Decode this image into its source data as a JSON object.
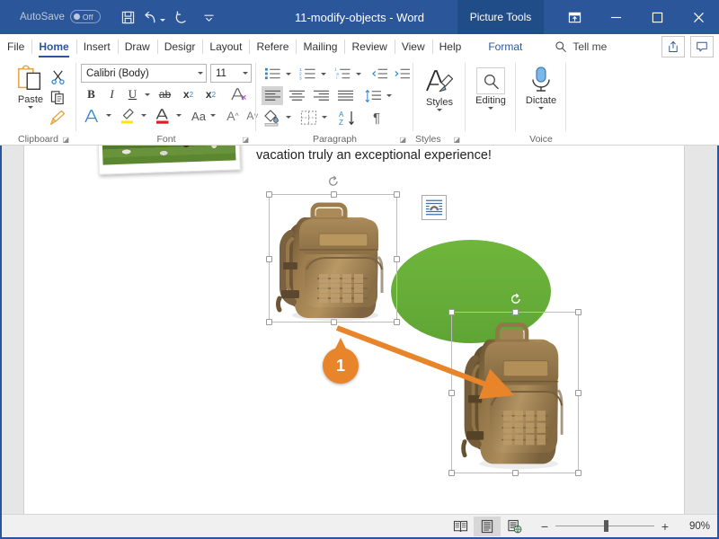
{
  "titlebar": {
    "autosave_label": "AutoSave",
    "autosave_state": "Off",
    "document_title": "11-modify-objects - Word",
    "contextual_tab": "Picture Tools",
    "qat": [
      {
        "name": "save-button",
        "icon": "save-icon"
      },
      {
        "name": "undo-button",
        "icon": "undo-icon"
      },
      {
        "name": "redo-button",
        "icon": "redo-icon"
      },
      {
        "name": "customize-quick-access-toolbar-button",
        "icon": "chevron-down-icon"
      }
    ],
    "window_controls": [
      {
        "name": "ribbon-display-options-button",
        "icon": "ribbon-display-icon"
      },
      {
        "name": "minimize-button",
        "icon": "minimize-icon"
      },
      {
        "name": "maximize-button",
        "icon": "maximize-icon"
      },
      {
        "name": "close-button",
        "icon": "close-icon"
      }
    ]
  },
  "tabs": [
    {
      "label": "File",
      "active": false
    },
    {
      "label": "Home",
      "active": true
    },
    {
      "label": "Insert",
      "active": false
    },
    {
      "label": "Draw",
      "active": false
    },
    {
      "label": "Desigr",
      "active": false
    },
    {
      "label": "Layout",
      "active": false
    },
    {
      "label": "Refere",
      "active": false
    },
    {
      "label": "Mailing",
      "active": false
    },
    {
      "label": "Review",
      "active": false
    },
    {
      "label": "View",
      "active": false
    },
    {
      "label": "Help",
      "active": false
    }
  ],
  "format_tab": "Format",
  "tell_me": "Tell me",
  "ribbon": {
    "groups": [
      {
        "name": "clipboard",
        "title": "Clipboard"
      },
      {
        "name": "font",
        "title": "Font"
      },
      {
        "name": "paragraph",
        "title": "Paragraph"
      },
      {
        "name": "styles",
        "title": "Styles"
      },
      {
        "name": "voice",
        "title": "Voice"
      }
    ],
    "clipboard": {
      "paste_label": "Paste",
      "cut_name": "cut-button",
      "copy_name": "copy-button",
      "format_painter_name": "format-painter-button"
    },
    "font": {
      "font_name": "Calibri (Body)",
      "font_size": "11",
      "bold": "B",
      "italic": "I",
      "underline": "U",
      "strikethrough": "ab",
      "subscript": "x",
      "superscript": "x",
      "grow_font": "A",
      "shrink_font": "A",
      "change_case": "Aa"
    },
    "styles": {
      "label": "Styles"
    },
    "editing": {
      "label": "Editing"
    },
    "voice": {
      "label": "Dictate"
    }
  },
  "document": {
    "text": "vacation truly an exceptional experience!",
    "photo_alt": "grass-photo-thumbnail",
    "shape_color": "#6FB63C",
    "badge_number": "1",
    "badge_color": "#E8852A",
    "arrow_color": "#E8852A",
    "layout_options_name": "layout-options-button"
  },
  "statusbar": {
    "views": [
      {
        "name": "read-mode-view-button",
        "selected": false
      },
      {
        "name": "print-layout-view-button",
        "selected": true
      },
      {
        "name": "web-layout-view-button",
        "selected": false
      }
    ],
    "zoom_out": "−",
    "zoom_in": "+",
    "zoom_level": "90%"
  }
}
